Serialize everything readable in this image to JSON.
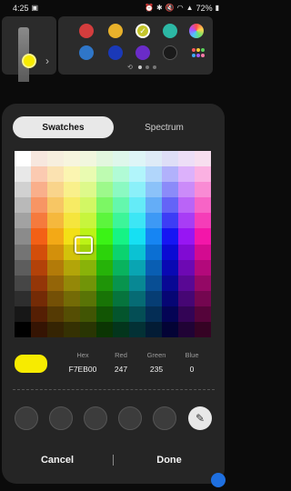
{
  "status_bar": {
    "time": "4:25",
    "battery": "72%",
    "icons": [
      "photo-icon",
      "alarm-icon",
      "bluetooth-icon",
      "mute-icon",
      "wifi-icon",
      "signal-icon",
      "battery-icon"
    ]
  },
  "pen": {
    "color": "#F7EB00",
    "icon": "pen-icon"
  },
  "palette": {
    "swatches_row1": [
      "#D33D3D",
      "#E8B12B",
      "#C4C52A",
      "#2CB8A5",
      "#B070D0"
    ],
    "swatches_row2": [
      "#2F76C8",
      "#1A39B8",
      "#6A2CC8",
      "#1A1A1A",
      "#E09A30"
    ],
    "selected_index": 2,
    "page_indicator": {
      "current": 1,
      "total": 3
    }
  },
  "dialog": {
    "tabs": [
      {
        "label": "Swatches",
        "selected": true
      },
      {
        "label": "Spectrum",
        "selected": false
      }
    ],
    "grid_columns": 12,
    "grid_rows": 12,
    "selected_cell": {
      "column": 4,
      "row": 6
    },
    "color_values": {
      "hex_label": "Hex",
      "hex_value": "F7EB00",
      "red_label": "Red",
      "red_value": "247",
      "green_label": "Green",
      "green_value": "235",
      "blue_label": "Blue",
      "blue_value": "0"
    },
    "recent_colors_count": 5,
    "eyedropper_icon": "eyedropper-icon",
    "cancel_label": "Cancel",
    "done_label": "Done"
  }
}
